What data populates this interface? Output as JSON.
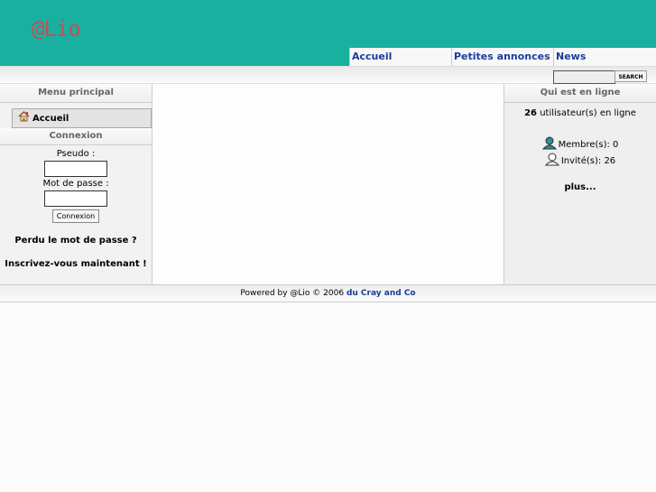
{
  "header": {
    "logo": "@Lio"
  },
  "nav": [
    {
      "label": "Accueil"
    },
    {
      "label": "Petites annonces"
    },
    {
      "label": "News"
    }
  ],
  "search": {
    "value": "",
    "button": "SEARCH"
  },
  "left": {
    "menu_title": "Menu principal",
    "menu_items": [
      {
        "label": "Accueil",
        "icon": "home-icon"
      }
    ],
    "login_title": "Connexion",
    "pseudo_label": "Pseudo :",
    "password_label": "Mot de passe :",
    "login_button": "Connexion",
    "lost_password": "Perdu le mot de passe ?",
    "register": "Inscrivez-vous maintenant !"
  },
  "right": {
    "title": "Qui est en ligne",
    "users_count": "26",
    "users_text": " utilisateur(s) en ligne",
    "members": "Membre(s): 0",
    "guests": "Invité(s): 26",
    "more": "plus..."
  },
  "footer": {
    "text": "Powered by @Lio © 2006 ",
    "link": "du Cray and Co"
  }
}
